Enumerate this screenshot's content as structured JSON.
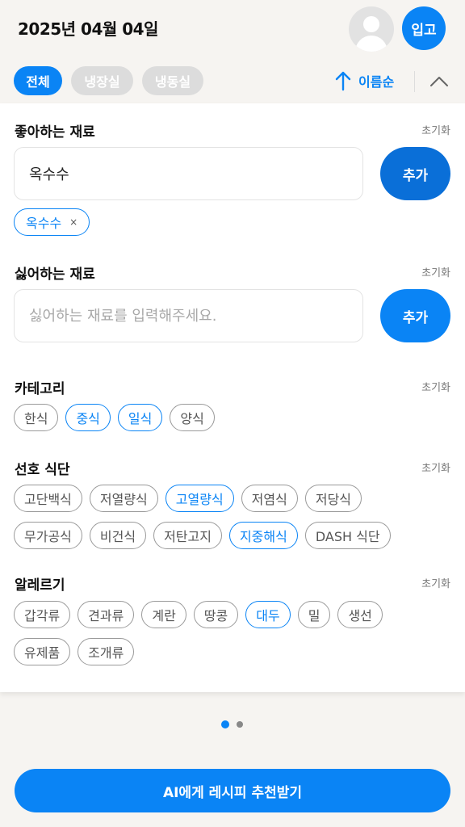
{
  "header": {
    "date": "2025년 04월 04일",
    "login_button": "입고"
  },
  "tabs": [
    {
      "label": "전체",
      "active": true
    },
    {
      "label": "냉장실",
      "active": false
    },
    {
      "label": "냉동실",
      "active": false
    }
  ],
  "sort": {
    "label": "이름순",
    "icon": "arrow-up-icon"
  },
  "reset_label": "초기화",
  "liked": {
    "title": "좋아하는 재료",
    "input_value": "옥수수",
    "add_label": "추가",
    "tags": [
      {
        "label": "옥수수",
        "remove": "×"
      }
    ]
  },
  "disliked": {
    "title": "싫어하는 재료",
    "placeholder": "싫어하는 재료를 입력해주세요.",
    "add_label": "추가"
  },
  "category": {
    "title": "카테고리",
    "chips": [
      {
        "label": "한식",
        "selected": false
      },
      {
        "label": "중식",
        "selected": true
      },
      {
        "label": "일식",
        "selected": true
      },
      {
        "label": "양식",
        "selected": false
      }
    ]
  },
  "diet": {
    "title": "선호 식단",
    "chips": [
      {
        "label": "고단백식",
        "selected": false
      },
      {
        "label": "저열량식",
        "selected": false
      },
      {
        "label": "고열량식",
        "selected": true
      },
      {
        "label": "저염식",
        "selected": false
      },
      {
        "label": "저당식",
        "selected": false
      },
      {
        "label": "무가공식",
        "selected": false
      },
      {
        "label": "비건식",
        "selected": false
      },
      {
        "label": "저탄고지",
        "selected": false
      },
      {
        "label": "지중해식",
        "selected": true
      },
      {
        "label": "DASH 식단",
        "selected": false
      }
    ]
  },
  "allergy": {
    "title": "알레르기",
    "chips": [
      {
        "label": "갑각류",
        "selected": false
      },
      {
        "label": "견과류",
        "selected": false
      },
      {
        "label": "계란",
        "selected": false
      },
      {
        "label": "땅콩",
        "selected": false
      },
      {
        "label": "대두",
        "selected": true
      },
      {
        "label": "밀",
        "selected": false
      },
      {
        "label": "생선",
        "selected": false
      },
      {
        "label": "유제품",
        "selected": false
      },
      {
        "label": "조개류",
        "selected": false
      }
    ]
  },
  "pager": {
    "current_page": 1,
    "total_pages": 2
  },
  "cta_label": "AI에게 레시피 추천받기",
  "colors": {
    "accent": "#0a84f5",
    "add_button_active": "#0a6fd8",
    "inactive_tab": "#dcdcdc",
    "background": "#f6f4f1"
  }
}
